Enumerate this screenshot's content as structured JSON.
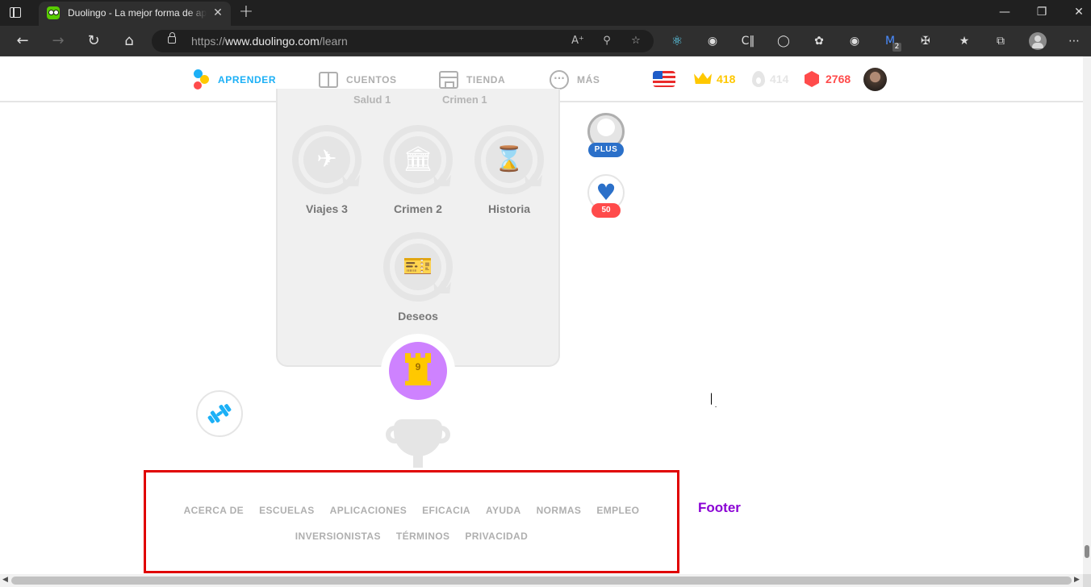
{
  "browser": {
    "tab_title": "Duolingo - La mejor forma de aprender un idioma",
    "close_glyph": "✕",
    "url_prefix": "https://",
    "url_domain": "www.duolingo.com",
    "url_path": "/learn",
    "extension_badge": "2"
  },
  "nav": {
    "learn": "APRENDER",
    "stories": "CUENTOS",
    "shop": "TIENDA",
    "more": "MÁS"
  },
  "stats": {
    "crowns": "418",
    "streak": "414",
    "gems": "2768"
  },
  "colors": {
    "accent_blue": "#1cb0f6",
    "crown_gold": "#ffc800",
    "gem_red": "#ff4b4b",
    "checkpoint_purple": "#ce82ff",
    "footer_highlight": "#e00000",
    "footer_tag": "#8a00d4"
  },
  "tree": {
    "cut_labels": [
      "Salud 1",
      "Crimen 1"
    ],
    "skills_row1": [
      {
        "name": "Viajes 3",
        "icon": "airplane-icon"
      },
      {
        "name": "Crimen 2",
        "icon": "courthouse-icon"
      },
      {
        "name": "Historia",
        "icon": "hourglass-icon"
      }
    ],
    "skill_row2": {
      "name": "Deseos",
      "icon": "wish-ticket-icon"
    },
    "checkpoint_number": "9"
  },
  "side": {
    "plus_label": "PLUS",
    "hearts_label": "50"
  },
  "footer": {
    "row1": [
      "ACERCA DE",
      "ESCUELAS",
      "APLICACIONES",
      "EFICACIA",
      "AYUDA",
      "NORMAS",
      "EMPLEO"
    ],
    "row2": [
      "INVERSIONISTAS",
      "TÉRMINOS",
      "PRIVACIDAD"
    ],
    "annotation": "Footer"
  }
}
